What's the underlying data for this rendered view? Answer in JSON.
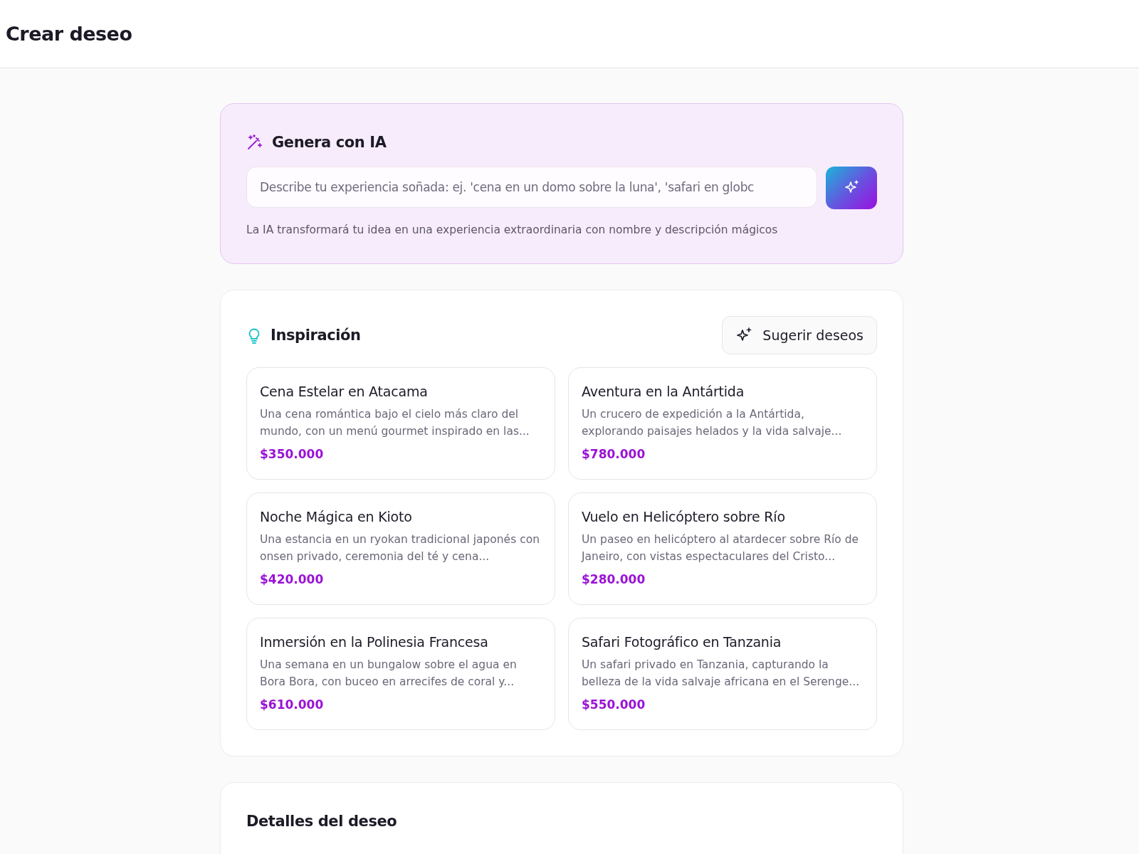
{
  "header": {
    "title": "Crear deseo"
  },
  "ai": {
    "title": "Genera con IA",
    "input": {
      "placeholder": "Describe tu experiencia soñada: ej. 'cena en un domo sobre la luna', 'safari en globc"
    },
    "hint": "La IA transformará tu idea en una experiencia extraordinaria con nombre y descripción mágicos"
  },
  "inspiration": {
    "title": "Inspiración",
    "suggest_button": "Sugerir deseos",
    "cards": [
      {
        "title": "Cena Estelar en Atacama",
        "description": "Una cena romántica bajo el cielo más claro del mundo, con un menú gourmet inspirado en las...",
        "price": "$350.000"
      },
      {
        "title": "Aventura en la Antártida",
        "description": "Un crucero de expedición a la Antártida, explorando paisajes helados y la vida salvaje...",
        "price": "$780.000"
      },
      {
        "title": "Noche Mágica en Kioto",
        "description": "Una estancia en un ryokan tradicional japonés con onsen privado, ceremonia del té y cena...",
        "price": "$420.000"
      },
      {
        "title": "Vuelo en Helicóptero sobre Río",
        "description": "Un paseo en helicóptero al atardecer sobre Río de Janeiro, con vistas espectaculares del Cristo...",
        "price": "$280.000"
      },
      {
        "title": "Inmersión en la Polinesia Francesa",
        "description": "Una semana en un bungalow sobre el agua en Bora Bora, con buceo en arrecifes de coral y...",
        "price": "$610.000"
      },
      {
        "title": "Safari Fotográfico en Tanzania",
        "description": "Un safari privado en Tanzania, capturando la belleza de la vida salvaje africana en el Serenge...",
        "price": "$550.000"
      }
    ]
  },
  "details": {
    "title": "Detalles del deseo"
  }
}
